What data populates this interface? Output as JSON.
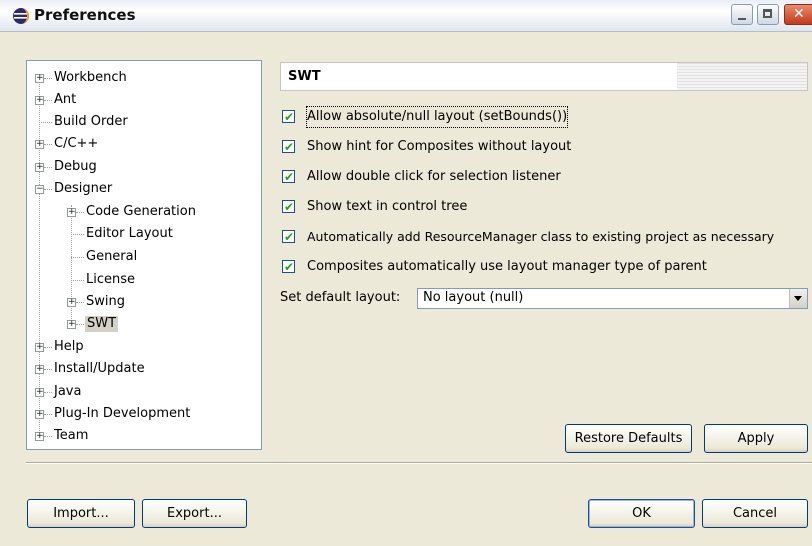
{
  "window": {
    "title": "Preferences"
  },
  "tree": {
    "items": [
      {
        "label": "Workbench",
        "expander": "+"
      },
      {
        "label": "Ant",
        "expander": "+"
      },
      {
        "label": "Build Order",
        "expander": ""
      },
      {
        "label": "C/C++",
        "expander": "+"
      },
      {
        "label": "Debug",
        "expander": "+"
      },
      {
        "label": "Designer",
        "expander": "−"
      },
      {
        "label": "Code Generation",
        "expander": "+"
      },
      {
        "label": "Editor Layout",
        "expander": ""
      },
      {
        "label": "General",
        "expander": ""
      },
      {
        "label": "License",
        "expander": ""
      },
      {
        "label": "Swing",
        "expander": "+"
      },
      {
        "label": "SWT",
        "expander": "+",
        "selected": true
      },
      {
        "label": "Help",
        "expander": "+"
      },
      {
        "label": "Install/Update",
        "expander": "+"
      },
      {
        "label": "Java",
        "expander": "+"
      },
      {
        "label": "Plug-In Development",
        "expander": "+"
      },
      {
        "label": "Team",
        "expander": "+"
      }
    ]
  },
  "page": {
    "title": "SWT",
    "options": [
      {
        "label": "Allow absolute/null layout (setBounds())",
        "checked": true
      },
      {
        "label": "Show hint for Composites without layout",
        "checked": true
      },
      {
        "label": "Allow double click for selection listener",
        "checked": true
      },
      {
        "label": "Show text in control tree",
        "checked": true
      },
      {
        "label": "Automatically add ResourceManager class to existing project as necessary",
        "checked": true
      },
      {
        "label": "Composites automatically use layout manager type of parent",
        "checked": true
      }
    ],
    "default_layout_label": "Set default layout:",
    "default_layout_value": "No layout (null)",
    "restore_defaults": "Restore Defaults",
    "apply": "Apply"
  },
  "footer": {
    "import": "Import...",
    "export": "Export...",
    "ok": "OK",
    "cancel": "Cancel"
  }
}
